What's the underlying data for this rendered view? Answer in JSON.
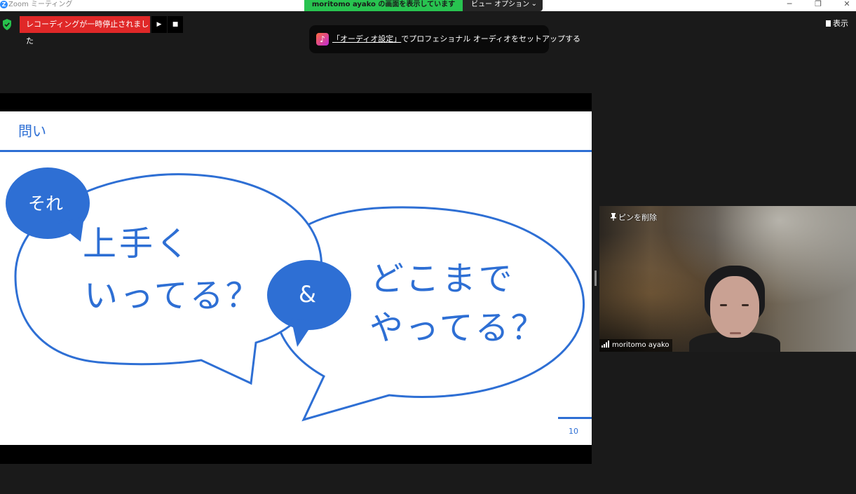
{
  "window": {
    "title": "Zoom ミーティング",
    "logo_letter": "Z",
    "share_banner": "moritomo ayako の画面を表示しています",
    "view_options_label": "ビュー オプション",
    "controls": {
      "minimize": "─",
      "restore": "❐",
      "close": "✕"
    }
  },
  "toolbar": {
    "recording_status": "レコーディングが一時停止されました",
    "resume_symbol": "▶",
    "stop_symbol": "■",
    "view_label": "表示"
  },
  "toast": {
    "icon": "music-note-icon",
    "note_glyph": "♪",
    "link_text": "「オーディオ設定」",
    "body_text": "でプロフェショナル オーディオをセットアップする"
  },
  "slide": {
    "title": "問い",
    "small_bubble_left": "それ",
    "left_bubble_line1": "上手く",
    "left_bubble_line2": "いってる？",
    "small_bubble_mid": "&",
    "right_bubble_line1": "どこまで",
    "right_bubble_line2": "やってる？",
    "page_number": "10",
    "accent_color": "#2e6fd4"
  },
  "participant": {
    "pin_label": "ピンを削除",
    "name": "moritomo ayako"
  },
  "colors": {
    "recording_red": "#e02828",
    "share_green": "#28c350",
    "meeting_bg": "#1a1a1a"
  }
}
